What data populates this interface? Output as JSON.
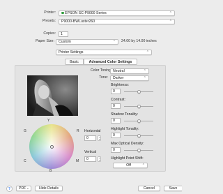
{
  "printer": {
    "label": "Printer:",
    "value": "EPSON SC-P9000 Series"
  },
  "presets": {
    "label": "Presets:",
    "value": "P9000-BWLuster260"
  },
  "copies": {
    "label": "Copies:",
    "value": "1"
  },
  "paper_size": {
    "label": "Paper Size:",
    "value": "Custom",
    "dims": "24.00 by 14.00 inches"
  },
  "section_popup": {
    "value": "Printer Settings"
  },
  "tabs": [
    {
      "label": "Basic",
      "active": false
    },
    {
      "label": "Advanced Color Settings",
      "active": true
    }
  ],
  "color_toning": {
    "label": "Color Toning:",
    "value": "Neutral"
  },
  "tone": {
    "label": "Tone:",
    "value": "Darker"
  },
  "brightness": {
    "label": "Brightness:",
    "value": "0"
  },
  "contrast": {
    "label": "Contrast:",
    "value": "0"
  },
  "shadow_tonality": {
    "label": "Shadow Tonality:",
    "value": "0"
  },
  "highlight_tonality": {
    "label": "Highlight Tonality:",
    "value": "0"
  },
  "max_optical_density": {
    "label": "Max Optical Density:",
    "value": "0"
  },
  "highlight_point_shift": {
    "label": "Highlight Point Shift:",
    "value": "Off"
  },
  "wheel": {
    "letters": {
      "top": "Y",
      "left": "G",
      "right": "R",
      "bottom_left": "C",
      "bottom_right": "M",
      "bottom": "B"
    },
    "horizontal": {
      "label": "Horizontal",
      "value": "0"
    },
    "vertical": {
      "label": "Vertical",
      "value": "0"
    }
  },
  "footer": {
    "help": "?",
    "pdf": "PDF",
    "hide_details": "Hide Details",
    "cancel": "Cancel",
    "save": "Save"
  },
  "colors": {
    "accent": "#3b82f6",
    "printer_dot": "#2e9c3a"
  }
}
